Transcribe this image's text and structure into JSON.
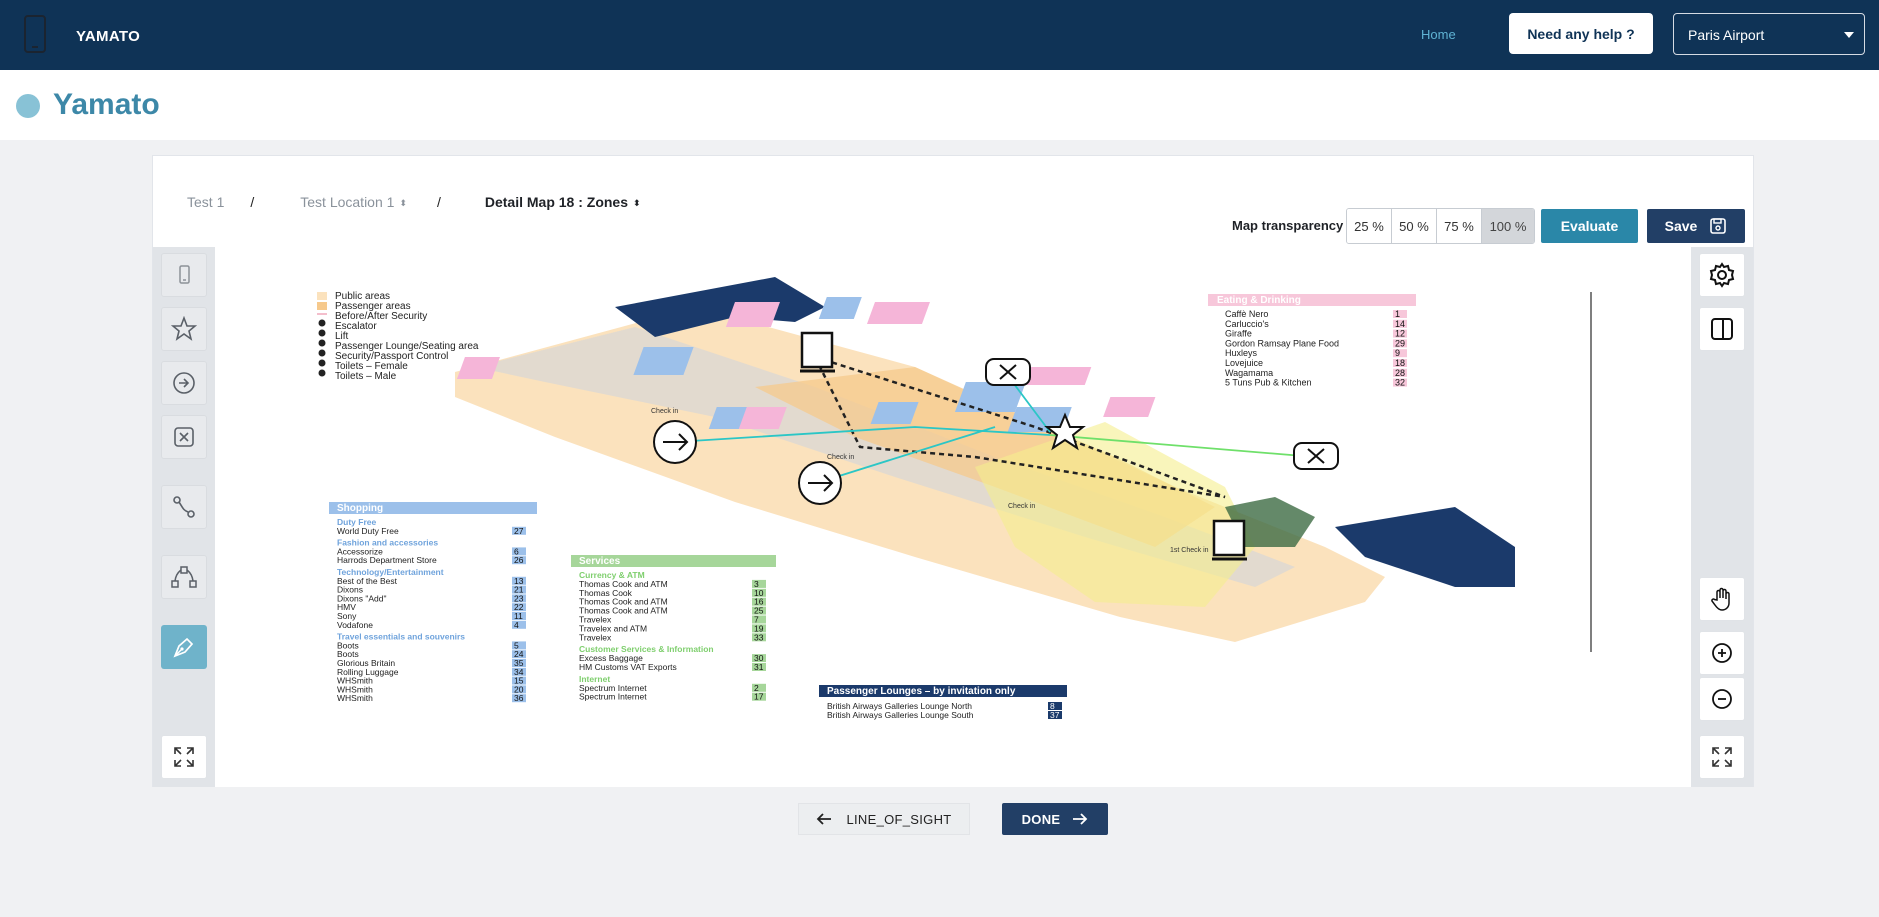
{
  "header": {
    "brand": "YAMATO",
    "nav_home": "Home",
    "help_button": "Need any help ?",
    "airport_select": "Paris Airport"
  },
  "page": {
    "title": "Yamato"
  },
  "breadcrumb": {
    "item1": "Test 1",
    "sep1": "/",
    "item2": "Test Location 1",
    "sep2": "/",
    "item3": "Detail Map 18 : Zones"
  },
  "toolbar": {
    "transparency_label": "Map transparency",
    "transparency_options": [
      "25 %",
      "50 %",
      "75 %",
      "100 %"
    ],
    "transparency_selected": "100 %",
    "evaluate_label": "Evaluate",
    "save_label": "Save"
  },
  "left_tools": [
    "device-icon",
    "star-icon",
    "arrow-circle-icon",
    "x-box-icon",
    "route-icon",
    "bezier-icon",
    "pen-icon",
    "expand-icon"
  ],
  "right_tools": [
    "gear-icon",
    "split-panel-icon",
    "hand-icon",
    "zoom-in-icon",
    "zoom-out-icon",
    "expand-icon"
  ],
  "map": {
    "legend": [
      "Public areas",
      "Passenger areas",
      "Before/After Security",
      "Escalator",
      "Lift",
      "Passenger Lounge/Seating area",
      "Security/Passport Control",
      "Toilets – Female",
      "Toilets – Male"
    ],
    "eating_title": "Eating & Drinking",
    "eating": [
      [
        "Caffè Nero",
        "1"
      ],
      [
        "Carluccio's",
        "14"
      ],
      [
        "Giraffe",
        "12"
      ],
      [
        "Gordon Ramsay Plane Food",
        "29"
      ],
      [
        "Huxleys",
        "9"
      ],
      [
        "Lovejuice",
        "18"
      ],
      [
        "Wagamama",
        "28"
      ],
      [
        "5 Tuns Pub & Kitchen",
        "32"
      ]
    ],
    "shopping_title": "Shopping",
    "shopping": [
      {
        "heading": "Duty Free",
        "items": [
          [
            "World Duty Free",
            "27"
          ]
        ]
      },
      {
        "heading": "Fashion and accessories",
        "items": [
          [
            "Accessorize",
            "6"
          ],
          [
            "Harrods Department Store",
            "26"
          ]
        ]
      },
      {
        "heading": "Technology/Entertainment",
        "items": [
          [
            "Best of the Best",
            "13"
          ],
          [
            "Dixons",
            "21"
          ],
          [
            "Dixons \"Add\"",
            "23"
          ],
          [
            "HMV",
            "22"
          ],
          [
            "Sony",
            "11"
          ],
          [
            "Vodafone",
            "4"
          ]
        ]
      },
      {
        "heading": "Travel essentials and souvenirs",
        "items": [
          [
            "Boots",
            "5"
          ],
          [
            "Boots",
            "24"
          ],
          [
            "Glorious Britain",
            "35"
          ],
          [
            "Rolling Luggage",
            "34"
          ],
          [
            "WHSmith",
            "15"
          ],
          [
            "WHSmith",
            "20"
          ],
          [
            "WHSmith",
            "36"
          ]
        ]
      }
    ],
    "services_title": "Services",
    "services": [
      {
        "heading": "Currency & ATM",
        "items": [
          [
            "Thomas Cook and ATM",
            "3"
          ],
          [
            "Thomas Cook",
            "10"
          ],
          [
            "Thomas Cook and ATM",
            "16"
          ],
          [
            "Thomas Cook and ATM",
            "25"
          ],
          [
            "Travelex",
            "7"
          ],
          [
            "Travelex and ATM",
            "19"
          ],
          [
            "Travelex",
            "33"
          ]
        ]
      },
      {
        "heading": "Customer Services & Information",
        "items": [
          [
            "Excess Baggage",
            "30"
          ],
          [
            "HM Customs VAT Exports",
            "31"
          ]
        ]
      },
      {
        "heading": "Internet",
        "items": [
          [
            "Spectrum Internet",
            "2"
          ],
          [
            "Spectrum Internet",
            "17"
          ]
        ]
      }
    ],
    "lounges_title": "Passenger Lounges – by invitation only",
    "lounges": [
      [
        "British Airways Galleries Lounge North",
        "8"
      ],
      [
        "British Airways Galleries Lounge South",
        "37"
      ]
    ],
    "labels": [
      "Check in",
      "Check in",
      "Check in",
      "1st Check in"
    ]
  },
  "nav": {
    "prev_label": "LINE_OF_SIGHT",
    "next_label": "DONE"
  }
}
